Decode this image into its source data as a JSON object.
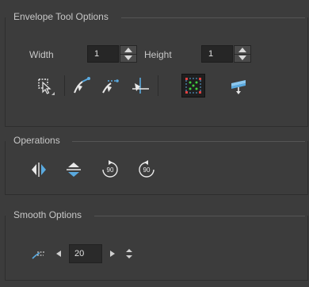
{
  "envelope": {
    "title": "Envelope Tool Options",
    "width_label": "Width",
    "width_value": "1",
    "height_label": "Height",
    "height_value": "1"
  },
  "operations": {
    "title": "Operations"
  },
  "smooth": {
    "title": "Smooth Options",
    "value": "20"
  },
  "colors": {
    "panel_bg": "#3c3c3c",
    "accent_blue": "#5aaae0",
    "icon_white": "#e8e8e8"
  },
  "icons": {
    "envelope_tools": [
      "lasso-select-icon",
      "bezier-handle-icon",
      "smooth-handle-icon",
      "corner-handle-icon",
      "grid-points-icon",
      "merge-layers-icon"
    ],
    "operations": [
      "flip-horizontal-icon",
      "flip-vertical-icon",
      "rotate-90-cw-icon",
      "rotate-90-ccw-icon"
    ]
  }
}
